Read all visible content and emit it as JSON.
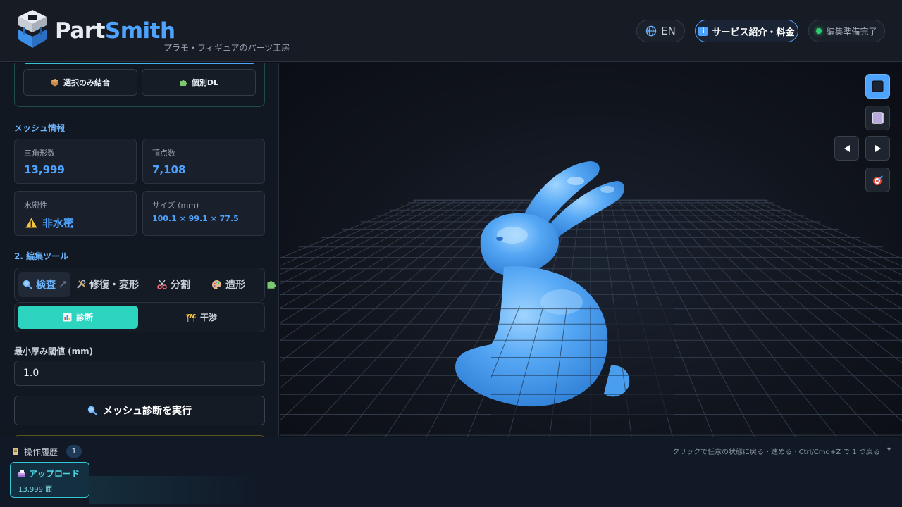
{
  "header": {
    "logo_part": "Part",
    "logo_smith": "Smith",
    "tagline": "プラモ・フィギュアのパーツ工房",
    "lang_label": "EN",
    "service_label": "サービス紹介・料金",
    "status_label": "編集準備完了"
  },
  "left_panel": {
    "merge_selected_label": "選択のみ結合",
    "download_each_label": "個別DL",
    "mesh_info_title": "メッシュ情報",
    "cards": [
      {
        "label": "三角形数",
        "value": "13,999"
      },
      {
        "label": "頂点数",
        "value": "7,108"
      },
      {
        "label": "水密性",
        "value": "非水密"
      },
      {
        "label": "サイズ (mm)",
        "value": "100.1 × 99.1 × 77.5"
      }
    ],
    "edit_tools_title": "2. 編集ツール",
    "tabs": [
      {
        "label": "検査"
      },
      {
        "label": "修復・変形"
      },
      {
        "label": "分割"
      },
      {
        "label": "造形"
      }
    ],
    "subtabs": [
      {
        "label": "診断"
      },
      {
        "label": "干渉"
      }
    ],
    "min_thickness_label": "最小厚み閾値 (mm)",
    "min_thickness_value": "1.0",
    "run_button_label": "メッシュ診断を実行"
  },
  "history": {
    "title": "操作履歴",
    "count": "1",
    "hint": "クリックで任意の状態に戻る・進める · Ctrl/Cmd+Z で 1 つ戻る",
    "hint_caret": "▾",
    "items": [
      {
        "title": "アップロード",
        "subtitle": "13,999 面"
      }
    ]
  },
  "colors": {
    "accent": "#4ea3ff",
    "teal": "#2dd4bf",
    "model": "#56a8f5"
  },
  "icons": {
    "lang": "globe-icon",
    "service": "info-icon",
    "status": "status-dot",
    "merge": "package-icon",
    "download": "puzzle-icon",
    "watertight": "warning-icon",
    "inspect": "magnifier-icon",
    "repair": "tools-icon",
    "split": "scissors-icon",
    "sculpt": "palette-icon",
    "diagnose": "chart-icon",
    "interference": "construction-icon",
    "history": "scroll-icon",
    "upload_item": "inbox-icon"
  }
}
